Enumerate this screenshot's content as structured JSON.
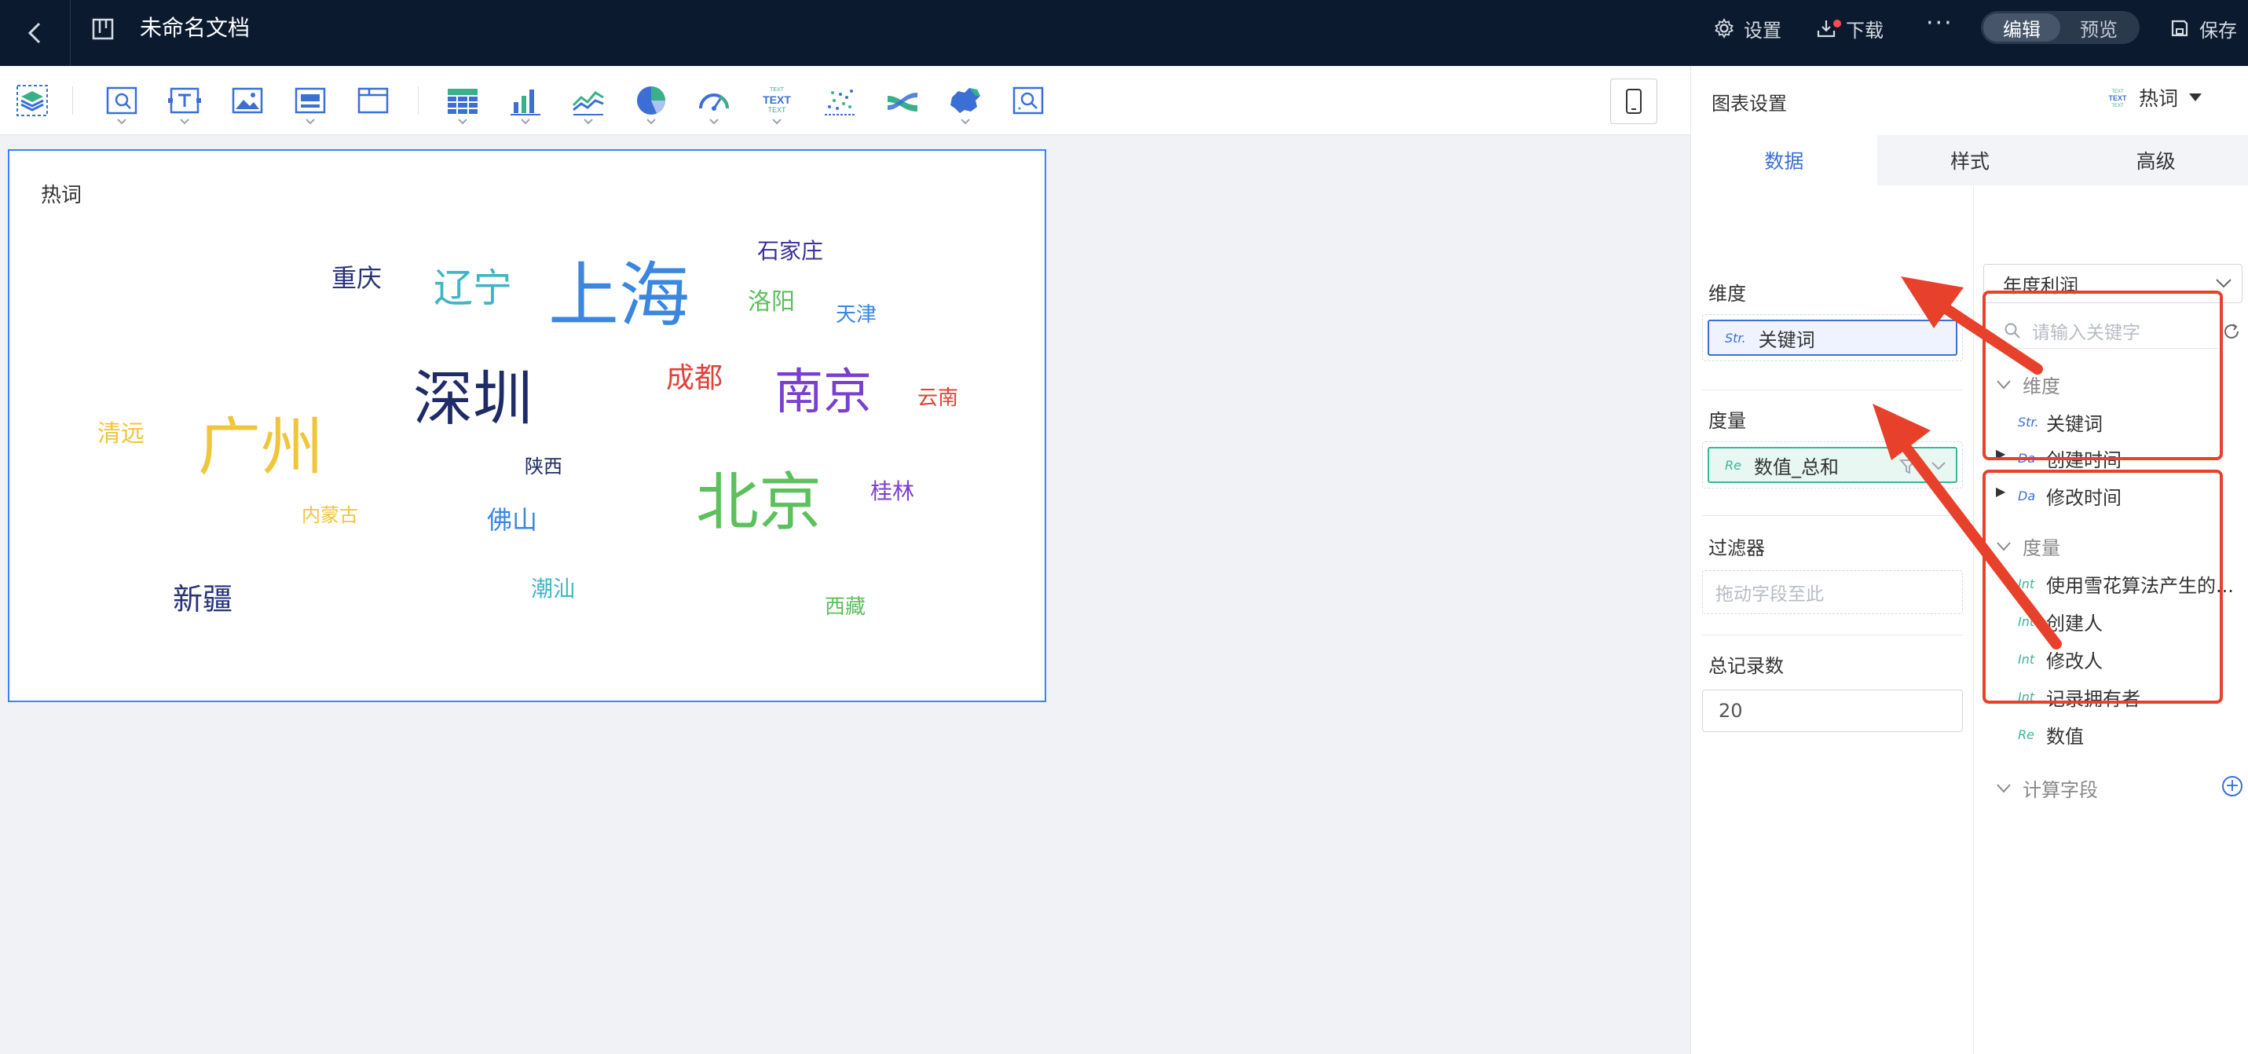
{
  "topbar": {
    "title": "未命名文档",
    "settings_label": "设置",
    "download_label": "下载",
    "more_label": "···",
    "mode_edit": "编辑",
    "mode_preview": "预览",
    "save_label": "保存"
  },
  "chart": {
    "title": "热词",
    "words": [
      {
        "text": "重庆",
        "color": "#27337a"
      },
      {
        "text": "辽宁",
        "color": "#3fb5c4"
      },
      {
        "text": "上海",
        "color": "#3a86e0"
      },
      {
        "text": "石家庄",
        "color": "#3c2f9a"
      },
      {
        "text": "洛阳",
        "color": "#5cc05c"
      },
      {
        "text": "天津",
        "color": "#3a86e0"
      },
      {
        "text": "深圳",
        "color": "#1e2b66"
      },
      {
        "text": "成都",
        "color": "#e0413a"
      },
      {
        "text": "南京",
        "color": "#7b3fd0"
      },
      {
        "text": "云南",
        "color": "#e0413a"
      },
      {
        "text": "清远",
        "color": "#f0c53a"
      },
      {
        "text": "广州",
        "color": "#f0c53a"
      },
      {
        "text": "陕西",
        "color": "#1e2b66"
      },
      {
        "text": "北京",
        "color": "#5cc05c"
      },
      {
        "text": "桂林",
        "color": "#7b3fd0"
      },
      {
        "text": "内蒙古",
        "color": "#f0c53a"
      },
      {
        "text": "佛山",
        "color": "#3a86e0"
      },
      {
        "text": "新疆",
        "color": "#27337a"
      },
      {
        "text": "潮汕",
        "color": "#3fb5c4"
      },
      {
        "text": "西藏",
        "color": "#5cc05c"
      }
    ]
  },
  "panel": {
    "title": "图表设置",
    "chart_type": "热词",
    "chart_type_icon_text": "TEXT",
    "tabs": [
      "数据",
      "样式",
      "高级"
    ],
    "dimension_label": "维度",
    "dimension_field": {
      "type": "Str.",
      "name": "关键词"
    },
    "measure_label": "度量",
    "measure_field": {
      "type": "Re",
      "name": "数值_总和"
    },
    "filter_label": "过滤器",
    "filter_placeholder": "拖动字段至此",
    "total_label": "总记录数",
    "total_value": "20",
    "dataset_select": "年度利润",
    "search_placeholder": "请输入关键字",
    "dim_group": {
      "label": "维度",
      "items": [
        {
          "type": "Str.",
          "name": "关键词"
        },
        {
          "type": "Da",
          "name": "创建时间"
        },
        {
          "type": "Da",
          "name": "修改时间"
        }
      ]
    },
    "mea_group": {
      "label": "度量",
      "items": [
        {
          "type": "Int",
          "name": "使用雪花算法产生的..."
        },
        {
          "type": "Int",
          "name": "创建人"
        },
        {
          "type": "Int",
          "name": "修改人"
        },
        {
          "type": "Int",
          "name": "记录拥有者"
        },
        {
          "type": "Re",
          "name": "数值"
        }
      ]
    },
    "calc_label": "计算字段"
  },
  "colors": {
    "accent": "#3b6fd6",
    "topbar_bg": "#0b1a2e",
    "annotation_red": "#e8412b"
  }
}
